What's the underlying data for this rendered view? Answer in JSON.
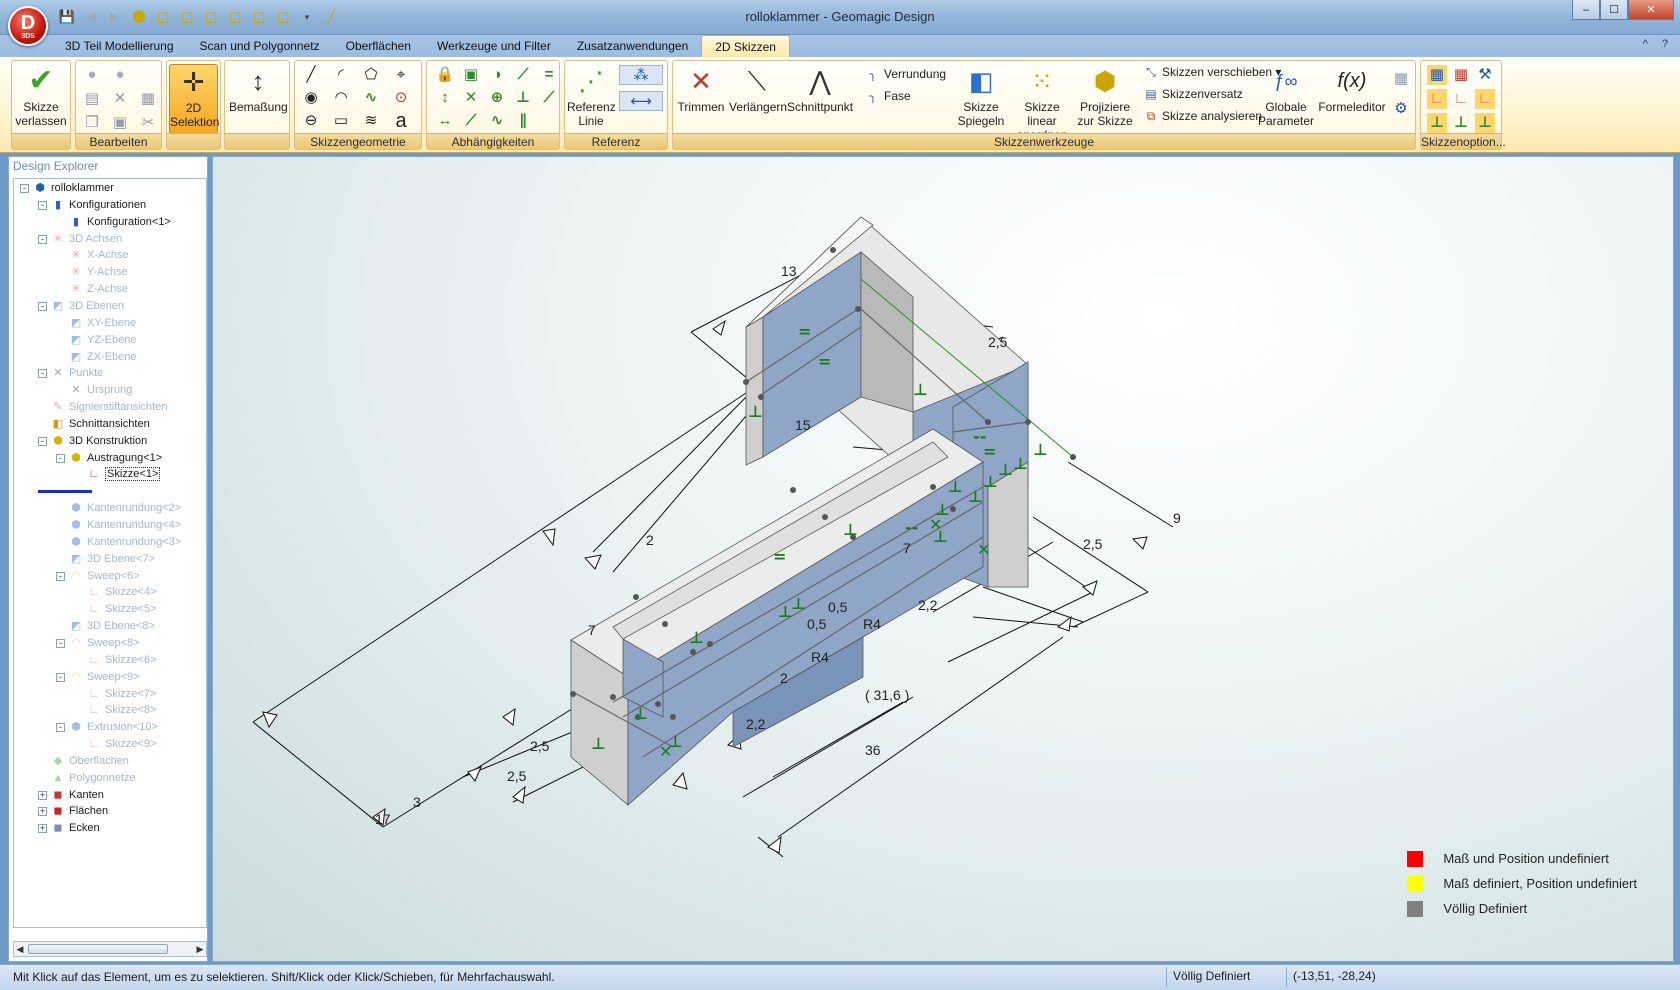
{
  "window": {
    "title": "rolloklammer - Geomagic Design",
    "logo_text": "D",
    "logo_sub": "3DS",
    "controls": [
      "–",
      "☐",
      "✕"
    ]
  },
  "menu": {
    "tabs": [
      "3D Teil Modellierung",
      "Scan und Polygonnetz",
      "Oberflächen",
      "Werkzeuge und Filter",
      "Zusatzanwendungen",
      "2D Skizzen"
    ],
    "active_tab": "2D Skizzen",
    "help": [
      "^",
      "?"
    ]
  },
  "ribbon": {
    "groups": {
      "exit": "",
      "edit": "Bearbeiten",
      "selection": "",
      "dimension": "",
      "geometry": "Skizzengeometrie",
      "constraints": "Abhängigkeiten",
      "reference": "Referenz",
      "tools": "Skizzenwerkzeuge",
      "options": "Skizzenoption..."
    },
    "buttons": {
      "exit_sketch": "Skizze verlassen",
      "selection_2d": "2D Selektion",
      "dimension": "Bemaßung",
      "ref_line": "Referenz Linie",
      "trim": "Trimmen",
      "extend": "Verlängern",
      "intersection": "Schnittpunkt",
      "fillet": "Verrundung",
      "chamfer": "Fase",
      "mirror": "Skizze Spiegeln",
      "linear_pattern": "Skizze linear anordnen",
      "project": "Projiziere zur Skizze",
      "move": "Skizzen verschieben",
      "offset": "Skizzenversatz",
      "analyze": "Skizze analysieren",
      "global_params": "Globale Parameter",
      "formula_editor": "Formeleditor"
    }
  },
  "explorer": {
    "title": "Design Explorer",
    "nodes": [
      {
        "label": "rolloklammer",
        "depth": 0,
        "exp": "-",
        "icon": "part-icon",
        "glyph": "⬢",
        "color": "#1f5fb3",
        "dim": false
      },
      {
        "label": "Konfigurationen",
        "depth": 1,
        "exp": "-",
        "icon": "config-icon",
        "glyph": "▮",
        "color": "#2f5fc7",
        "dim": false
      },
      {
        "label": "Konfiguration<1>",
        "depth": 2,
        "exp": "",
        "icon": "config-icon",
        "glyph": "▮",
        "color": "#2f5fc7",
        "dim": false
      },
      {
        "label": "3D Achsen",
        "depth": 1,
        "exp": "-",
        "icon": "axis-icon",
        "glyph": "✳",
        "color": "#c0392b",
        "dim": true
      },
      {
        "label": "X-Achse",
        "depth": 2,
        "exp": "",
        "icon": "axis-icon",
        "glyph": "✳",
        "color": "#c0392b",
        "dim": true
      },
      {
        "label": "Y-Achse",
        "depth": 2,
        "exp": "",
        "icon": "axis-icon",
        "glyph": "✳",
        "color": "#c0392b",
        "dim": true
      },
      {
        "label": "Z-Achse",
        "depth": 2,
        "exp": "",
        "icon": "axis-icon",
        "glyph": "✳",
        "color": "#c0392b",
        "dim": true
      },
      {
        "label": "3D Ebenen",
        "depth": 1,
        "exp": "-",
        "icon": "plane-icon",
        "glyph": "◩",
        "color": "#2f6fd0",
        "dim": true
      },
      {
        "label": "XY-Ebene",
        "depth": 2,
        "exp": "",
        "icon": "plane-icon",
        "glyph": "◩",
        "color": "#2f6fd0",
        "dim": true
      },
      {
        "label": "YZ-Ebene",
        "depth": 2,
        "exp": "",
        "icon": "plane-icon",
        "glyph": "◩",
        "color": "#2f6fd0",
        "dim": true
      },
      {
        "label": "ZX-Ebene",
        "depth": 2,
        "exp": "",
        "icon": "plane-icon",
        "glyph": "◩",
        "color": "#2f6fd0",
        "dim": true
      },
      {
        "label": "Punkte",
        "depth": 1,
        "exp": "-",
        "icon": "point-icon",
        "glyph": "✕",
        "color": "#334",
        "dim": true
      },
      {
        "label": "Ursprung",
        "depth": 2,
        "exp": "",
        "icon": "point-icon",
        "glyph": "✕",
        "color": "#334",
        "dim": true
      },
      {
        "label": "Signierstiftansichten",
        "depth": 1,
        "exp": "",
        "icon": "pen-view-icon",
        "glyph": "✎",
        "color": "#c0392b",
        "dim": true
      },
      {
        "label": "Schnittansichten",
        "depth": 1,
        "exp": "",
        "icon": "section-view-icon",
        "glyph": "◧",
        "color": "#d99a00",
        "dim": false
      },
      {
        "label": "3D Konstruktion",
        "depth": 1,
        "exp": "-",
        "icon": "construction-icon",
        "glyph": "⬢",
        "color": "#d9b100",
        "dim": false
      },
      {
        "label": "Austragung<1>",
        "depth": 2,
        "exp": "-",
        "icon": "extrude-icon",
        "glyph": "⬢",
        "color": "#d9b100",
        "dim": false
      },
      {
        "label": "Skizze<1>",
        "depth": 3,
        "exp": "",
        "icon": "sketch-icon",
        "glyph": "∟",
        "color": "#c0392b",
        "dim": false,
        "sel": true
      },
      {
        "label": "",
        "depth": 1,
        "exp": "",
        "icon": "rollback-bar-icon",
        "glyph": "",
        "color": "#1a2fd0",
        "dim": false,
        "bar": true
      },
      {
        "label": "Kantenrundung<2>",
        "depth": 2,
        "exp": "",
        "icon": "fillet-icon",
        "glyph": "⬢",
        "color": "#3a6fd0",
        "dim": true
      },
      {
        "label": "Kantenrundung<4>",
        "depth": 2,
        "exp": "",
        "icon": "fillet-icon",
        "glyph": "⬢",
        "color": "#3a6fd0",
        "dim": true
      },
      {
        "label": "Kantenrundung<3>",
        "depth": 2,
        "exp": "",
        "icon": "fillet-icon",
        "glyph": "⬢",
        "color": "#3a6fd0",
        "dim": true
      },
      {
        "label": "3D Ebene<7>",
        "depth": 2,
        "exp": "",
        "icon": "plane-icon",
        "glyph": "◩",
        "color": "#2f6fd0",
        "dim": true
      },
      {
        "label": "Sweep<6>",
        "depth": 2,
        "exp": "-",
        "icon": "sweep-icon",
        "glyph": "◠",
        "color": "#d9b100",
        "dim": true
      },
      {
        "label": "Skizze<4>",
        "depth": 3,
        "exp": "",
        "icon": "sketch-icon",
        "glyph": "∟",
        "color": "#c0392b",
        "dim": true
      },
      {
        "label": "Skizze<5>",
        "depth": 3,
        "exp": "",
        "icon": "sketch-icon",
        "glyph": "∟",
        "color": "#c0392b",
        "dim": true
      },
      {
        "label": "3D Ebene<8>",
        "depth": 2,
        "exp": "",
        "icon": "plane-icon",
        "glyph": "◩",
        "color": "#2f6fd0",
        "dim": true
      },
      {
        "label": "Sweep<8>",
        "depth": 2,
        "exp": "-",
        "icon": "sweep-icon",
        "glyph": "◠",
        "color": "#d9b100",
        "dim": true
      },
      {
        "label": "Skizze<6>",
        "depth": 3,
        "exp": "",
        "icon": "sketch-icon",
        "glyph": "∟",
        "color": "#c0392b",
        "dim": true
      },
      {
        "label": "Sweep<9>",
        "depth": 2,
        "exp": "-",
        "icon": "sweep-icon",
        "glyph": "◠",
        "color": "#d9b100",
        "dim": true
      },
      {
        "label": "Skizze<7>",
        "depth": 3,
        "exp": "",
        "icon": "sketch-icon",
        "glyph": "∟",
        "color": "#c0392b",
        "dim": true
      },
      {
        "label": "Skizze<8>",
        "depth": 3,
        "exp": "",
        "icon": "sketch-icon",
        "glyph": "∟",
        "color": "#c0392b",
        "dim": true
      },
      {
        "label": "Extrusion<10>",
        "depth": 2,
        "exp": "-",
        "icon": "extrusion-icon",
        "glyph": "⬢",
        "color": "#3a6fd0",
        "dim": true
      },
      {
        "label": "Skizze<9>",
        "depth": 3,
        "exp": "",
        "icon": "sketch-icon",
        "glyph": "∟",
        "color": "#c0392b",
        "dim": true
      },
      {
        "label": "Oberflächen",
        "depth": 1,
        "exp": "",
        "icon": "surface-icon",
        "glyph": "◆",
        "color": "#3a9a3a",
        "dim": true
      },
      {
        "label": "Polygonnetze",
        "depth": 1,
        "exp": "",
        "icon": "mesh-icon",
        "glyph": "▲",
        "color": "#3a9a3a",
        "dim": true
      },
      {
        "label": "Kanten",
        "depth": 1,
        "exp": "+",
        "icon": "edges-icon",
        "glyph": "◼",
        "color": "#c0392b",
        "dim": false
      },
      {
        "label": "Flächen",
        "depth": 1,
        "exp": "+",
        "icon": "faces-icon",
        "glyph": "◼",
        "color": "#d02020",
        "dim": false
      },
      {
        "label": "Ecken",
        "depth": 1,
        "exp": "+",
        "icon": "vertices-icon",
        "glyph": "◼",
        "color": "#7b8fb0",
        "dim": false
      }
    ]
  },
  "viewport": {
    "dimensions": [
      "13",
      "2,5",
      "15",
      "9",
      "2,5",
      "2",
      "2,2",
      "0,5",
      "0,5",
      "R4",
      "R4",
      "7",
      "7",
      "2",
      "( 31,6 )",
      "2,2",
      "36",
      "2,5",
      "2,5",
      "3",
      "17"
    ],
    "legend": [
      {
        "label": "Maß und Position undefiniert",
        "color": "#ff0000"
      },
      {
        "label": "Maß definiert, Position undefiniert",
        "color": "#ffff00"
      },
      {
        "label": "Völlig Definiert",
        "color": "#808080"
      }
    ]
  },
  "status": {
    "message": "Mit Klick auf das Element, um es zu selektieren. Shift/Klick oder Klick/Schieben, für Mehrfachauswahl.",
    "state": "Völlig Definiert",
    "coords": "(-13,51, -28,24)"
  }
}
